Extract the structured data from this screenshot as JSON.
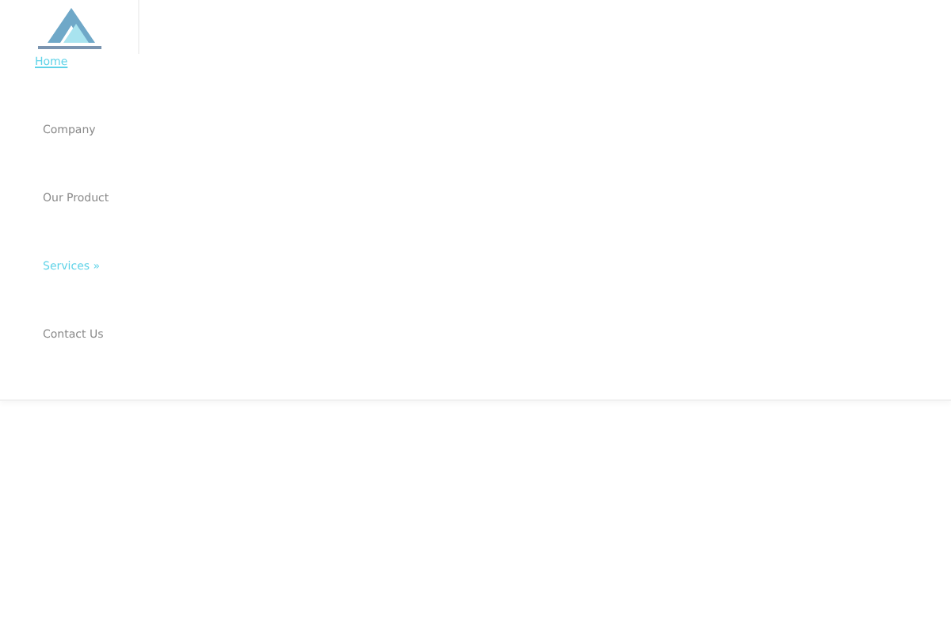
{
  "nav": [
    {
      "label": "Home",
      "selected": true
    },
    {
      "label": "Company",
      "selected": false
    },
    {
      "label": "Our Product",
      "selected": false
    },
    {
      "label": "Services »",
      "selected": true
    },
    {
      "label": "Contact Us",
      "selected": false
    }
  ]
}
